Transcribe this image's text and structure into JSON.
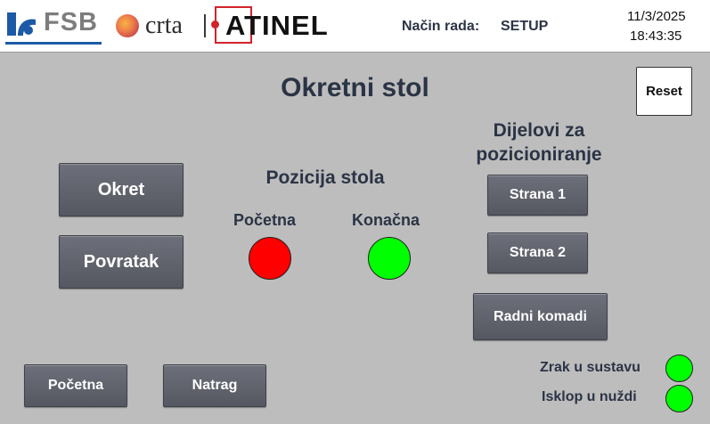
{
  "header": {
    "logos": {
      "fsb_text": "FSB",
      "crta_text": "crta",
      "atinel_text": "ATINEL"
    },
    "mode_label": "Način rada:",
    "mode_value": "SETUP",
    "date": "11/3/2025",
    "time": "18:43:35"
  },
  "main": {
    "title": "Okretni stol",
    "reset_label": "Reset",
    "okret_label": "Okret",
    "povratak_label": "Povratak",
    "position_heading": "Pozicija stola",
    "position_lamps": [
      {
        "label": "Početna",
        "state": "red",
        "color": "#ff0000"
      },
      {
        "label": "Konačna",
        "state": "green",
        "color": "#00ff00"
      }
    ],
    "parts_heading": "Dijelovi za pozicioniranje",
    "parts_buttons": [
      "Strana 1",
      "Strana 2",
      "Radni komadi"
    ]
  },
  "footer": {
    "nav_buttons": [
      "Početna",
      "Natrag"
    ],
    "status": [
      {
        "label": "Zrak u sustavu",
        "color": "#00ff00"
      },
      {
        "label": "Isklop u nuždi",
        "color": "#00ff00"
      }
    ]
  },
  "colors": {
    "background": "#bdbdbd",
    "button": "#5f626b",
    "text_dark": "#2b3445",
    "accent_red": "#d2232a",
    "accent_blue": "#1d5aa6"
  }
}
